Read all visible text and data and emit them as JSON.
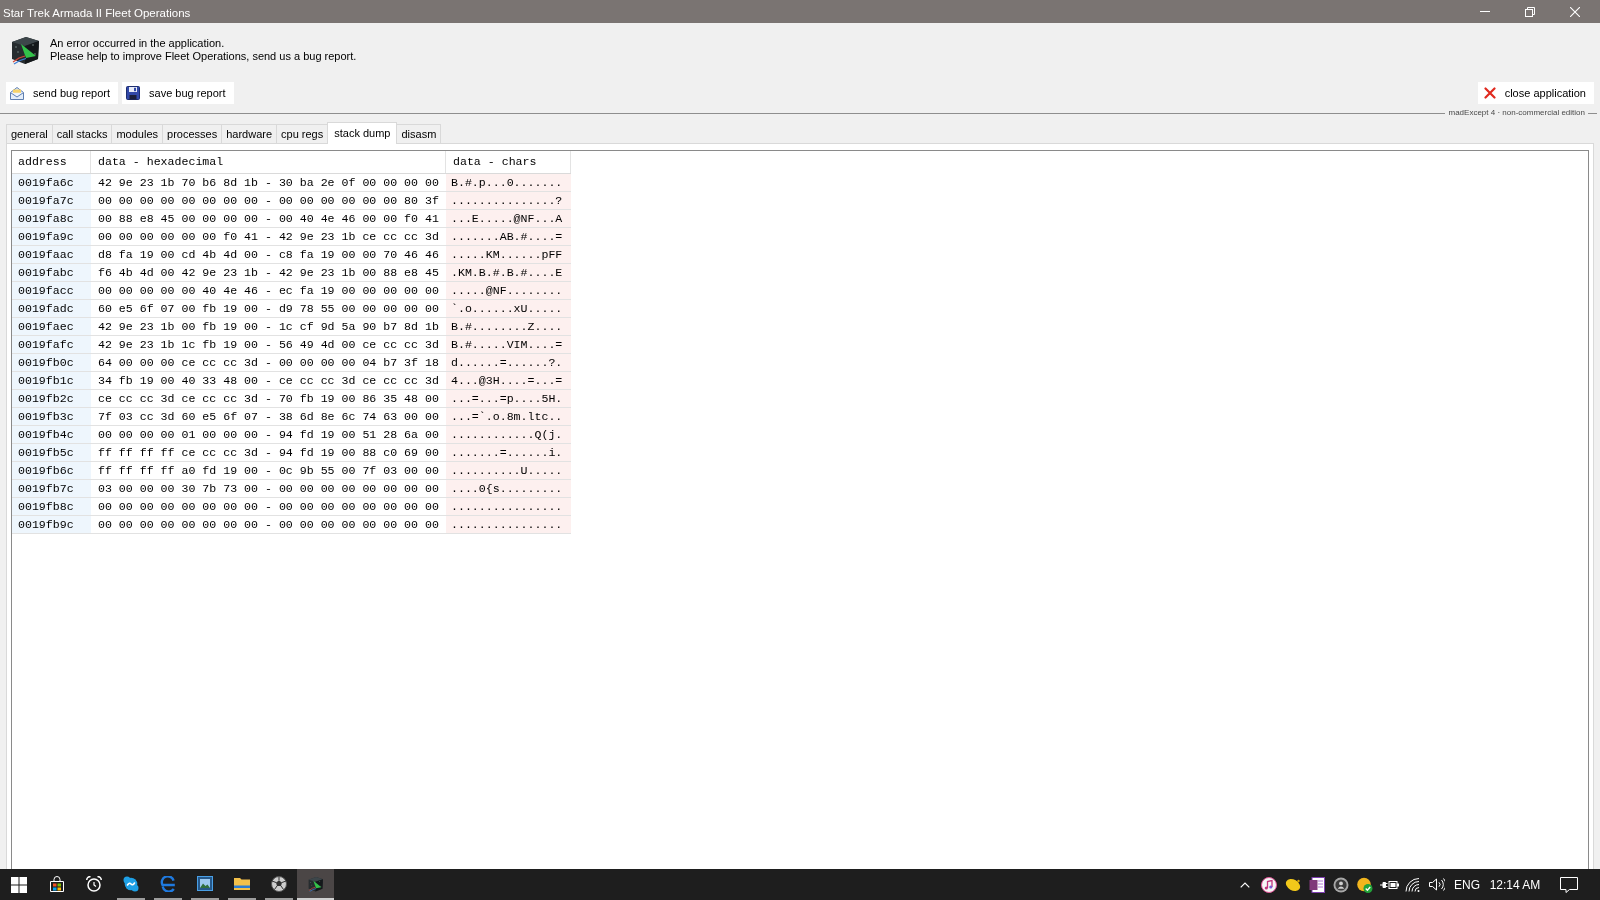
{
  "window": {
    "title": "Star Trek Armada II Fleet Operations"
  },
  "message": {
    "lines": [
      "An error occurred in the application.",
      "Please help to improve Fleet Operations, send us a bug report."
    ]
  },
  "actions": [
    {
      "kind": "send",
      "label": "send bug report"
    },
    {
      "kind": "save",
      "label": "save bug report"
    }
  ],
  "close_action": {
    "label": "close application"
  },
  "edition_note": "madExcept 4 · non-commercial edition",
  "tabs": [
    {
      "label": "general",
      "selected": false
    },
    {
      "label": "call stacks",
      "selected": false
    },
    {
      "label": "modules",
      "selected": false
    },
    {
      "label": "processes",
      "selected": false
    },
    {
      "label": "hardware",
      "selected": false
    },
    {
      "label": "cpu regs",
      "selected": false
    },
    {
      "label": "stack dump",
      "selected": true
    },
    {
      "label": "disasm",
      "selected": false
    }
  ],
  "stack_dump": {
    "columns": [
      "address",
      "data - hexadecimal",
      "data - chars"
    ],
    "rows": [
      {
        "address": "0019fa6c",
        "hex": "42 9e 23 1b 70 b6 8d 1b - 30 ba 2e 0f 00 00 00 00",
        "chars": "B.#.p...0......."
      },
      {
        "address": "0019fa7c",
        "hex": "00 00 00 00 00 00 00 00 - 00 00 00 00 00 00 80 3f",
        "chars": "...............?"
      },
      {
        "address": "0019fa8c",
        "hex": "00 88 e8 45 00 00 00 00 - 00 40 4e 46 00 00 f0 41",
        "chars": "...E.....@NF...A"
      },
      {
        "address": "0019fa9c",
        "hex": "00 00 00 00 00 00 f0 41 - 42 9e 23 1b ce cc cc 3d",
        "chars": ".......AB.#....="
      },
      {
        "address": "0019faac",
        "hex": "d8 fa 19 00 cd 4b 4d 00 - c8 fa 19 00 00 70 46 46",
        "chars": ".....KM......pFF"
      },
      {
        "address": "0019fabc",
        "hex": "f6 4b 4d 00 42 9e 23 1b - 42 9e 23 1b 00 88 e8 45",
        "chars": ".KM.B.#.B.#....E"
      },
      {
        "address": "0019facc",
        "hex": "00 00 00 00 00 40 4e 46 - ec fa 19 00 00 00 00 00",
        "chars": ".....@NF........"
      },
      {
        "address": "0019fadc",
        "hex": "60 e5 6f 07 00 fb 19 00 - d9 78 55 00 00 00 00 00",
        "chars": "`.o......xU....."
      },
      {
        "address": "0019faec",
        "hex": "42 9e 23 1b 00 fb 19 00 - 1c cf 9d 5a 90 b7 8d 1b",
        "chars": "B.#........Z...."
      },
      {
        "address": "0019fafc",
        "hex": "42 9e 23 1b 1c fb 19 00 - 56 49 4d 00 ce cc cc 3d",
        "chars": "B.#.....VIM....="
      },
      {
        "address": "0019fb0c",
        "hex": "64 00 00 00 ce cc cc 3d - 00 00 00 00 04 b7 3f 18",
        "chars": "d......=......?."
      },
      {
        "address": "0019fb1c",
        "hex": "34 fb 19 00 40 33 48 00 - ce cc cc 3d ce cc cc 3d",
        "chars": "4...@3H....=...="
      },
      {
        "address": "0019fb2c",
        "hex": "ce cc cc 3d ce cc cc 3d - 70 fb 19 00 86 35 48 00",
        "chars": "...=...=p....5H."
      },
      {
        "address": "0019fb3c",
        "hex": "7f 03 cc 3d 60 e5 6f 07 - 38 6d 8e 6c 74 63 00 00",
        "chars": "...=`.o.8m.ltc.."
      },
      {
        "address": "0019fb4c",
        "hex": "00 00 00 00 01 00 00 00 - 94 fd 19 00 51 28 6a 00",
        "chars": "............Q(j."
      },
      {
        "address": "0019fb5c",
        "hex": "ff ff ff ff ce cc cc 3d - 94 fd 19 00 88 c0 69 00",
        "chars": ".......=......i."
      },
      {
        "address": "0019fb6c",
        "hex": "ff ff ff ff a0 fd 19 00 - 0c 9b 55 00 7f 03 00 00",
        "chars": "..........U....."
      },
      {
        "address": "0019fb7c",
        "hex": "03 00 00 00 30 7b 73 00 - 00 00 00 00 00 00 00 00",
        "chars": "....0{s........."
      },
      {
        "address": "0019fb8c",
        "hex": "00 00 00 00 00 00 00 00 - 00 00 00 00 00 00 00 00",
        "chars": "................"
      },
      {
        "address": "0019fb9c",
        "hex": "00 00 00 00 00 00 00 00 - 00 00 00 00 00 00 00 00",
        "chars": "................"
      }
    ]
  },
  "taskbar": {
    "apps": [
      {
        "kind": "store",
        "running": false,
        "selected": false
      },
      {
        "kind": "clock",
        "running": false,
        "selected": false
      },
      {
        "kind": "chat",
        "running": true,
        "selected": false
      },
      {
        "kind": "browser",
        "running": true,
        "selected": false
      },
      {
        "kind": "photos",
        "running": true,
        "selected": false
      },
      {
        "kind": "folder",
        "running": true,
        "selected": false
      },
      {
        "kind": "sphere",
        "running": true,
        "selected": false
      },
      {
        "kind": "cube",
        "running": true,
        "selected": true
      }
    ],
    "tray": {
      "language": "ENG",
      "time": "12:14 AM"
    }
  }
}
